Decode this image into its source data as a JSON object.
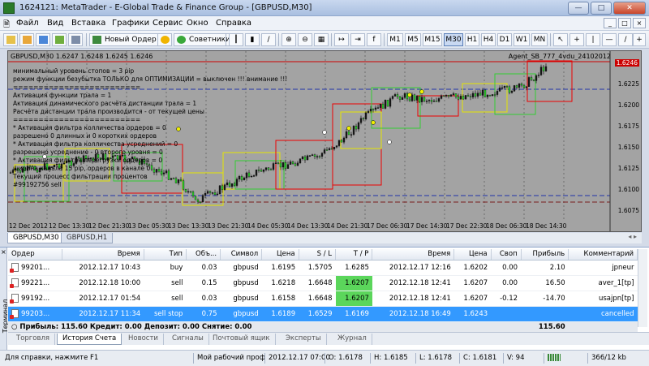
{
  "window": {
    "title": "1624121: MetaTrader - E-Global Trade & Finance Group - [GBPUSD,M30]"
  },
  "menu": [
    "Файл",
    "Вид",
    "Вставка",
    "Графики",
    "Сервис",
    "Окно",
    "Справка"
  ],
  "toolbar": {
    "new_order": "Новый Ордер",
    "advisors": "Советники",
    "timeframes": [
      "M1",
      "M5",
      "M15",
      "M30",
      "H1",
      "H4",
      "D1",
      "W1",
      "MN"
    ],
    "active_timeframe": "M30"
  },
  "chart": {
    "header": "GBPUSD,M30  1.6247 1.6248 1.6245 1.6246",
    "agent": "Agent_SB_777_4vdu_24102012",
    "info_lines": [
      "минимальный уровень стопов = 3 pip",
      "режим функции безубытка ТОЛЬКО для ОПТИМИЗАЦИИ = выключен !!! внимание !!!",
      "=========================",
      "Активация функции трала = 1",
      "Активация динамического расчёта дистанции трала = 1",
      "Расчёта дистанции трала производится - от текущей цены",
      "=========================",
      "* Активация фильтра колличества ордеров = 0",
      "разрешено 0 длинных и 0 коротких ордеров",
      "* Активация фильтра колличества усреднений = 0",
      "разрешено усреднение - 0 второго уровня = 0",
      "* Активация фильтра перегрузки ордеров = 0",
      "ширина канала 15 pip, ордеров в канале 0",
      "Текущий процесс фильтрации процентов",
      "#99192756 sell"
    ],
    "price_labels": [
      "1.6250",
      "1.6225",
      "1.6200",
      "1.6175",
      "1.6150",
      "1.6125",
      "1.6100",
      "1.6075"
    ],
    "current_price": "1.6246",
    "time_labels": [
      "12 Dec 2012",
      "12 Dec 13:30",
      "12 Dec 21:30",
      "13 Dec 05:30",
      "13 Dec 13:30",
      "13 Dec 21:30",
      "14 Dec 05:30",
      "14 Dec 13:30",
      "14 Dec 21:30",
      "17 Dec 06:30",
      "17 Dec 14:30",
      "17 Dec 22:30",
      "18 Dec 06:30",
      "18 Dec 14:30"
    ],
    "tabs": [
      "GBPUSD,M30",
      "GBPUSD,H1"
    ]
  },
  "orders": {
    "columns": [
      "Ордер",
      "Время",
      "Тип",
      "Объ...",
      "Символ",
      "Цена",
      "S / L",
      "T / P",
      "Время",
      "Цена",
      "Своп",
      "Прибыль",
      "Комментарий"
    ],
    "rows": [
      [
        "99201...",
        "2012.12.17 10:43",
        "buy",
        "0.03",
        "gbpusd",
        "1.6195",
        "1.5705",
        "1.6285",
        "2012.12.17 12:16",
        "1.6202",
        "0.00",
        "2.10",
        "jpneur"
      ],
      [
        "99221...",
        "2012.12.18 10:00",
        "sell",
        "0.15",
        "gbpusd",
        "1.6218",
        "1.6648",
        "1.6207",
        "2012.12.18 12:41",
        "1.6207",
        "0.00",
        "16.50",
        "aver_1[tp]"
      ],
      [
        "99192...",
        "2012.12.17 01:54",
        "sell",
        "0.03",
        "gbpusd",
        "1.6158",
        "1.6648",
        "1.6207",
        "2012.12.18 12:41",
        "1.6207",
        "-0.12",
        "-14.70",
        "usajpn[tp]"
      ],
      [
        "99203...",
        "2012.12.17 11:34",
        "sell stop",
        "0.75",
        "gbpusd",
        "1.6189",
        "1.6529",
        "1.6169",
        "2012.12.18 16:49",
        "1.6243",
        "",
        "",
        "cancelled"
      ]
    ],
    "summary": "Прибыль: 115.60  Кредит: 0.00  Депозит: 0.00  Снятие: 0.00",
    "summary_total": "115.60"
  },
  "terminal": {
    "side_label": "Терминал",
    "tabs": [
      "Торговля",
      "История Счета",
      "Новости",
      "Сигналы",
      "Почтовый ящик",
      "Эксперты",
      "Журнал"
    ],
    "active_tab": "История Счета"
  },
  "status": {
    "help": "Для справки, нажмите F1",
    "profile": "Мой рабочий проф",
    "datetime": "2012.12.17 07:00",
    "open": "O: 1.6178",
    "high": "H: 1.6185",
    "low": "L: 1.6178",
    "close": "C: 1.6181",
    "volume": "V: 94",
    "traffic": "366/12 kb"
  }
}
